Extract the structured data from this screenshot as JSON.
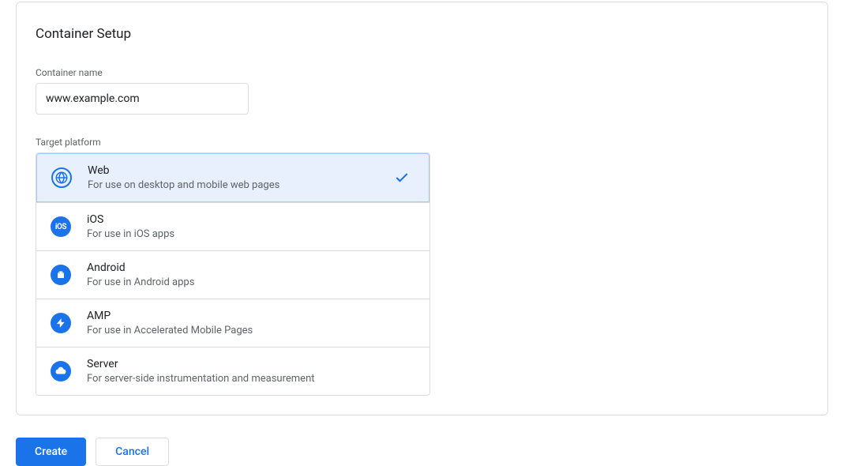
{
  "card": {
    "title": "Container Setup",
    "name_label": "Container name",
    "name_value": "www.example.com",
    "platform_label": "Target platform"
  },
  "platforms": [
    {
      "icon": "globe-icon",
      "title": "Web",
      "desc": "For use on desktop and mobile web pages",
      "selected": true
    },
    {
      "icon": "ios-icon",
      "title": "iOS",
      "desc": "For use in iOS apps",
      "selected": false
    },
    {
      "icon": "android-icon",
      "title": "Android",
      "desc": "For use in Android apps",
      "selected": false
    },
    {
      "icon": "amp-icon",
      "title": "AMP",
      "desc": "For use in Accelerated Mobile Pages",
      "selected": false
    },
    {
      "icon": "server-icon",
      "title": "Server",
      "desc": "For server-side instrumentation and measurement",
      "selected": false
    }
  ],
  "buttons": {
    "create": "Create",
    "cancel": "Cancel"
  }
}
